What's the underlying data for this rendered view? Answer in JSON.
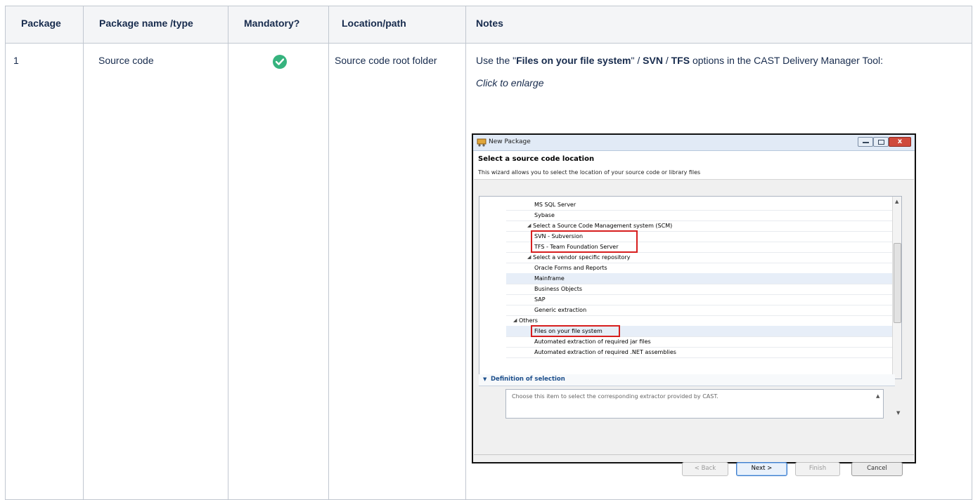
{
  "table": {
    "headers": {
      "package": "Package",
      "name": "Package name /type",
      "mandatory": "Mandatory?",
      "location": "Location/path",
      "notes": "Notes"
    },
    "rows": [
      {
        "package": "1",
        "name": "Source code",
        "mandatory_icon": "check-circle-icon",
        "location": "Source code root folder",
        "notes_pre": "Use the \"",
        "notes_b1": "Files on your file system",
        "notes_mid1": "\" / ",
        "notes_b2": "SVN",
        "notes_mid2": " / ",
        "notes_b3": "TFS",
        "notes_post": " options in the CAST Delivery Manager Tool:",
        "enlarge": "Click to enlarge"
      }
    ]
  },
  "dialog": {
    "title": "New Package",
    "heading": "Select a source code location",
    "subheading": "This wizard allows you to select the location of your source code or library files",
    "tree": [
      "MS SQL Server",
      "Sybase",
      "Select a Source Code Management system (SCM)",
      "SVN - Subversion",
      "TFS - Team Foundation Server",
      "Select a vendor specific repository",
      "Oracle Forms and Reports",
      "Mainframe",
      "Business Objects",
      "SAP",
      "Generic extraction",
      "Others",
      "Files on your file system",
      "Automated extraction of required jar files",
      "Automated extraction of required .NET assemblies"
    ],
    "definition_label": "Definition of selection",
    "definition_text": "Choose this item to select the corresponding extractor provided by CAST.",
    "buttons": {
      "back": "< Back",
      "next": "Next >",
      "finish": "Finish",
      "cancel": "Cancel"
    },
    "close_glyph": "x",
    "colors": {
      "highlight": "#d71e1e",
      "check": "#36b37e"
    }
  }
}
